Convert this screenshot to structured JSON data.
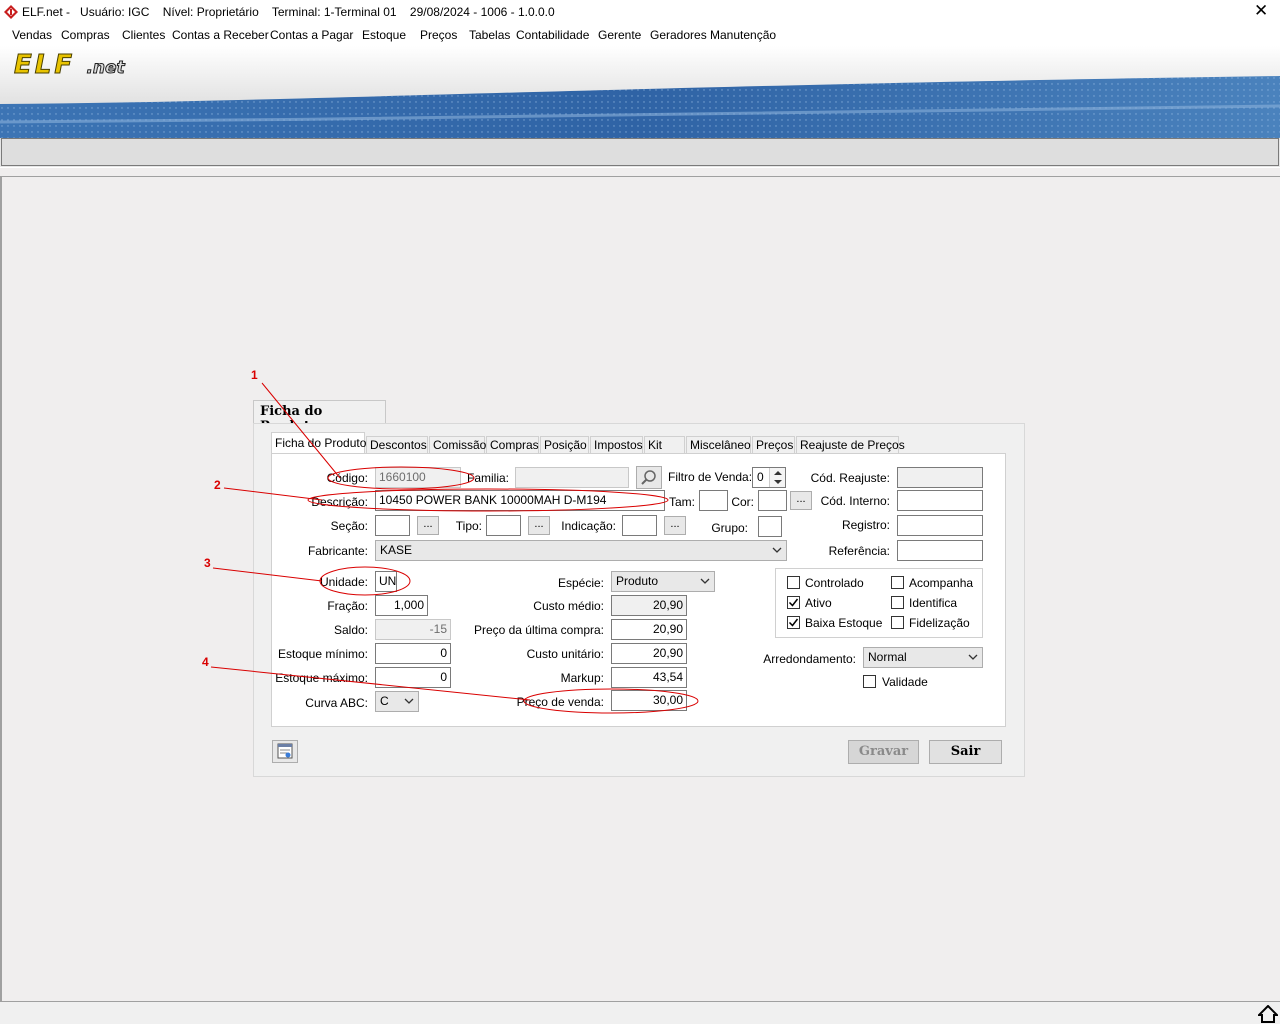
{
  "window": {
    "title": "ELF.net -   Usuário: IGC    Nível: Proprietário    Terminal: 1-Terminal 01    29/08/2024 - 1006 - 1.0.0.0",
    "close_glyph": "✕"
  },
  "menu": [
    "Vendas",
    "Compras",
    "Clientes",
    "Contas a Receber",
    "Contas a Pagar",
    "Estoque",
    "Preços",
    "Tabelas",
    "Contabilidade",
    "Gerente",
    "Geradores",
    "Manutenção"
  ],
  "banner": {
    "logo_text": "ELF",
    "logo_suffix": ".net"
  },
  "form": {
    "title": "Ficha do Produto",
    "tabs": [
      "Ficha do Produto",
      "Descontos",
      "Comissão",
      "Compras",
      "Posição",
      "Impostos",
      "Kit",
      "Miscelâneo",
      "Preços",
      "Reajuste de Preços"
    ],
    "labels": {
      "codigo": "Código:",
      "familia": "Familia:",
      "filtro_venda": "Filtro de Venda:",
      "cod_reajuste": "Cód. Reajuste:",
      "descricao": "Descrição:",
      "tam": "Tam:",
      "cor": "Cor:",
      "cod_interno": "Cód. Interno:",
      "secao": "Seção:",
      "tipo": "Tipo:",
      "indicacao": "Indicação:",
      "grupo": "Grupo:",
      "registro": "Registro:",
      "fabricante": "Fabricante:",
      "referencia": "Referência:",
      "unidade": "Unidade:",
      "especie": "Espécie:",
      "fracao": "Fração:",
      "custo_medio": "Custo médio:",
      "saldo": "Saldo:",
      "preco_ultima": "Preço da última compra:",
      "estoque_min": "Estoque mínimo:",
      "custo_unitario": "Custo unitário:",
      "estoque_max": "Estoque máximo:",
      "markup": "Markup:",
      "curva_abc": "Curva ABC:",
      "preco_venda": "Preço de venda:",
      "arredondamento": "Arredondamento:"
    },
    "values": {
      "codigo": "1660100",
      "familia": "",
      "filtro_venda": "0",
      "cod_reajuste": "",
      "descricao": "10450 POWER BANK 10000MAH D-M194",
      "tam": "",
      "cor": "",
      "cod_interno": "",
      "secao": "",
      "tipo": "",
      "indicacao": "",
      "grupo": "",
      "registro": "",
      "fabricante": "KASE",
      "referencia": "",
      "unidade": "UN",
      "especie": "Produto",
      "fracao": "1,000",
      "custo_medio": "20,90",
      "saldo": "-15",
      "preco_ultima": "20,90",
      "estoque_min": "0",
      "custo_unitario": "20,90",
      "estoque_max": "0",
      "markup": "43,54",
      "curva_abc": "C",
      "preco_venda": "30,00",
      "arredondamento": "Normal"
    },
    "dots_label": "...",
    "checkboxes": [
      {
        "label": "Controlado",
        "checked": false
      },
      {
        "label": "Acompanha",
        "checked": false
      },
      {
        "label": "Ativo",
        "checked": true
      },
      {
        "label": "Identifica",
        "checked": false
      },
      {
        "label": "Baixa Estoque",
        "checked": true
      },
      {
        "label": "Fidelização",
        "checked": false
      }
    ],
    "validade": {
      "label": "Validade",
      "checked": false
    },
    "buttons": {
      "gravar": "Gravar",
      "sair": "Sair"
    }
  },
  "annotations": [
    "1",
    "2",
    "3",
    "4"
  ],
  "colors": {
    "annotation": "#d90000",
    "banner_blue": "#3a6ea8",
    "background": "#f0eeee"
  }
}
